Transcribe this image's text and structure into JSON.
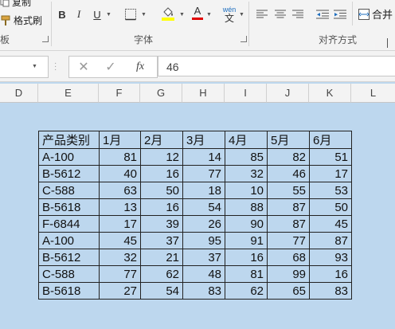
{
  "clipboard": {
    "copy_label": "复制",
    "format_painter_label": "格式刷",
    "group_label": "板"
  },
  "font": {
    "group_label": "字体",
    "bold_label": "B",
    "italic_label": "I",
    "underline_label": "U",
    "font_color_label": "A",
    "phonetic_top": "wén",
    "phonetic_bottom": "文"
  },
  "alignment": {
    "group_label": "对齐方式",
    "merge_label": "合并"
  },
  "formula_bar": {
    "fx_label": "fx",
    "value": "46"
  },
  "columns": [
    "D",
    "E",
    "F",
    "G",
    "H",
    "I",
    "J",
    "K",
    "L"
  ],
  "table": {
    "headers": [
      "产品类别",
      "1月",
      "2月",
      "3月",
      "4月",
      "5月",
      "6月"
    ],
    "rows": [
      [
        "A-100",
        "81",
        "12",
        "14",
        "85",
        "82",
        "51"
      ],
      [
        "B-5612",
        "40",
        "16",
        "77",
        "32",
        "46",
        "17"
      ],
      [
        "C-588",
        "63",
        "50",
        "18",
        "10",
        "55",
        "53"
      ],
      [
        "B-5618",
        "13",
        "16",
        "54",
        "88",
        "87",
        "50"
      ],
      [
        "F-6844",
        "17",
        "39",
        "26",
        "90",
        "87",
        "45"
      ],
      [
        "A-100",
        "45",
        "37",
        "95",
        "91",
        "77",
        "87"
      ],
      [
        "B-5612",
        "32",
        "21",
        "37",
        "16",
        "68",
        "93"
      ],
      [
        "C-588",
        "77",
        "62",
        "48",
        "81",
        "99",
        "16"
      ],
      [
        "B-5618",
        "27",
        "54",
        "83",
        "62",
        "65",
        "83"
      ]
    ]
  },
  "colors": {
    "sheet_background": "#bdd7ee",
    "ribbon_background": "#f3f3f3",
    "fill_highlight": "#ffff00",
    "font_color_red": "#e00000"
  }
}
